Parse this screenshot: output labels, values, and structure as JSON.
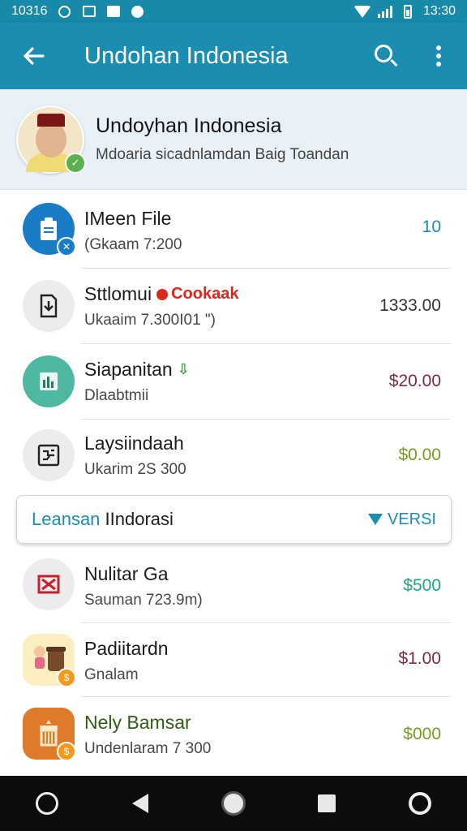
{
  "status_bar": {
    "time_left": "10316",
    "time_right": "13:30"
  },
  "app_bar": {
    "title": "Undohan Indonesia",
    "back_icon": "arrow-left-icon",
    "search_icon": "search-icon",
    "menu_icon": "more-vert-icon"
  },
  "profile": {
    "name": "Undoyhan Indonesia",
    "subtitle": "Mdoaria sicadnlamdan Baig Toandan"
  },
  "items": [
    {
      "title": "IMeen File",
      "subtitle": "(Gkaam 7:200",
      "value": "10",
      "value_color": "#1a8db0",
      "icon": "clipboard-icon",
      "icon_bg": "#1a7cc7"
    },
    {
      "title": "Sttlomui",
      "tag": "Cookaak",
      "subtitle": "Ukaaim 7.300I01 \")",
      "value": "1333.00",
      "value_color": "#333333",
      "icon": "download-file-icon",
      "icon_bg": "#ececec"
    },
    {
      "title": "Siapanitan",
      "tag_green": "⇩",
      "subtitle": "Dlaabtmii",
      "value": "$20.00",
      "value_color": "#7a2b3d",
      "icon": "bar-chart-icon",
      "icon_bg": "#4fb8a2"
    },
    {
      "title": "Laysiindaah",
      "subtitle": "Ukarim 2S 300",
      "value": "$0.00",
      "value_color": "#7a9a1f",
      "icon": "circuit-icon",
      "icon_bg": "#ececec"
    }
  ],
  "section": {
    "label_start": "Leansan",
    "label_end": " IIndorasi",
    "action": "VERSI"
  },
  "items2": [
    {
      "title": "Nulitar Ga",
      "subtitle": "Sauman 723.9m)",
      "value": "$500",
      "value_color": "#1fa38a",
      "icon": "x-box-icon",
      "icon_bg": "#ececec"
    },
    {
      "title": "Padiitardn",
      "subtitle": "Gnalam",
      "value": "$1.00",
      "value_color": "#7a2b3d",
      "icon": "doll-icon",
      "icon_bg": "#fbeec0"
    },
    {
      "title": "Nely Bamsar",
      "subtitle": "Undenlaram 7 300",
      "value": "$000",
      "value_color": "#7a9a1f",
      "icon": "lantern-icon",
      "icon_bg": "#e07a2b"
    }
  ],
  "nav": {
    "icons": [
      "assistant-icon",
      "back-icon",
      "home-icon",
      "recents-icon",
      "account-icon"
    ]
  }
}
